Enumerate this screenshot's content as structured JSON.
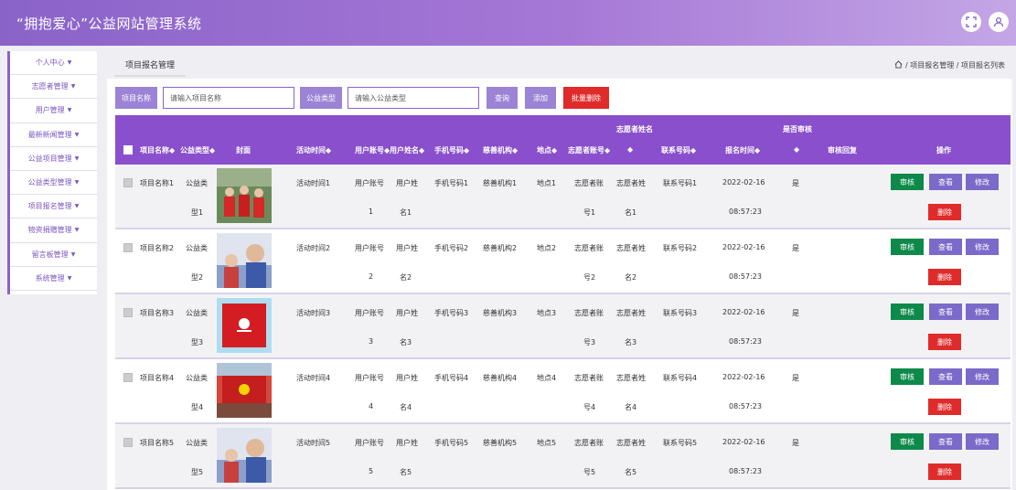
{
  "app": {
    "title": "“拥抱爱心”公益网站管理系统"
  },
  "sidebar": {
    "items": [
      {
        "label": "个人中心"
      },
      {
        "label": "志愿者管理"
      },
      {
        "label": "用户管理"
      },
      {
        "label": "最新新闻管理"
      },
      {
        "label": "公益项目管理"
      },
      {
        "label": "公益类型管理"
      },
      {
        "label": "项目报名管理"
      },
      {
        "label": "物资捐赠管理"
      },
      {
        "label": "留言板管理"
      },
      {
        "label": "系统管理"
      }
    ]
  },
  "page": {
    "tab": "项目报名管理",
    "breadcrumb": "/ 项目报名管理 / 项目报名列表"
  },
  "search": {
    "name_label": "项目名称",
    "name_placeholder": "请输入项目名称",
    "type_label": "公益类型",
    "type_placeholder": "请输入公益类型",
    "query_btn": "查询",
    "add_btn": "添加",
    "batch_delete_btn": "批量删除"
  },
  "table": {
    "group_headers": {
      "volunteer_name": "志愿者姓名",
      "reviewed": "是否审核"
    },
    "headers": {
      "project_name": "项目名称◆",
      "type": "公益类型◆",
      "cover": "封面",
      "activity_time": "活动时间◆",
      "user_account": "用户账号◆",
      "user_name": "用户姓名◆",
      "phone": "手机号码◆",
      "charity": "慈善机构◆",
      "location": "地点◆",
      "volunteer_account": "志愿者账号◆",
      "volunteer_name_sort": "◆",
      "contact": "联系号码◆",
      "signup_time": "报名时间◆",
      "reviewed_sort": "◆",
      "review_reply": "审核回复",
      "actions": "操作"
    },
    "rows": [
      {
        "name": "项目名称1",
        "type1": "公益类",
        "type2": "型1",
        "time": "活动时间1",
        "acct1": "用户账号",
        "acct2": "1",
        "uname1": "用户姓",
        "uname2": "名1",
        "phone": "手机号码1",
        "charity": "慈善机构1",
        "loc": "地点1",
        "vacct1": "志愿者账",
        "vacct2": "号1",
        "vname1": "志愿者姓",
        "vname2": "名1",
        "contact": "联系号码1",
        "date": "2022-02-16",
        "clock": "08:57:23",
        "reviewed": "是"
      },
      {
        "name": "项目名称2",
        "type1": "公益类",
        "type2": "型2",
        "time": "活动时间2",
        "acct1": "用户账号",
        "acct2": "2",
        "uname1": "用户姓",
        "uname2": "名2",
        "phone": "手机号码2",
        "charity": "慈善机构2",
        "loc": "地点2",
        "vacct1": "志愿者账",
        "vacct2": "号2",
        "vname1": "志愿者姓",
        "vname2": "名2",
        "contact": "联系号码2",
        "date": "2022-02-16",
        "clock": "08:57:23",
        "reviewed": "是"
      },
      {
        "name": "项目名称3",
        "type1": "公益类",
        "type2": "型3",
        "time": "活动时间3",
        "acct1": "用户账号",
        "acct2": "3",
        "uname1": "用户姓",
        "uname2": "名3",
        "phone": "手机号码3",
        "charity": "慈善机构3",
        "loc": "地点3",
        "vacct1": "志愿者账",
        "vacct2": "号3",
        "vname1": "志愿者姓",
        "vname2": "名3",
        "contact": "联系号码3",
        "date": "2022-02-16",
        "clock": "08:57:23",
        "reviewed": "是"
      },
      {
        "name": "项目名称4",
        "type1": "公益类",
        "type2": "型4",
        "time": "活动时间4",
        "acct1": "用户账号",
        "acct2": "4",
        "uname1": "用户姓",
        "uname2": "名4",
        "phone": "手机号码4",
        "charity": "慈善机构4",
        "loc": "地点4",
        "vacct1": "志愿者账",
        "vacct2": "号4",
        "vname1": "志愿者姓",
        "vname2": "名4",
        "contact": "联系号码4",
        "date": "2022-02-16",
        "clock": "08:57:23",
        "reviewed": "是"
      },
      {
        "name": "项目名称5",
        "type1": "公益类",
        "type2": "型5",
        "time": "活动时间5",
        "acct1": "用户账号",
        "acct2": "5",
        "uname1": "用户姓",
        "uname2": "名5",
        "phone": "手机号码5",
        "charity": "慈善机构5",
        "loc": "地点5",
        "vacct1": "志愿者账",
        "vacct2": "号5",
        "vname1": "志愿者姓",
        "vname2": "名5",
        "contact": "联系号码5",
        "date": "2022-02-16",
        "clock": "08:57:23",
        "reviewed": "是"
      }
    ],
    "actions": {
      "review": "审核",
      "view": "查看",
      "edit": "修改",
      "delete": "删除"
    }
  },
  "colors": {
    "brand": "#8a63c9",
    "header": "#8a4fcc",
    "danger": "#e02b2b",
    "success": "#0d8a4a"
  }
}
